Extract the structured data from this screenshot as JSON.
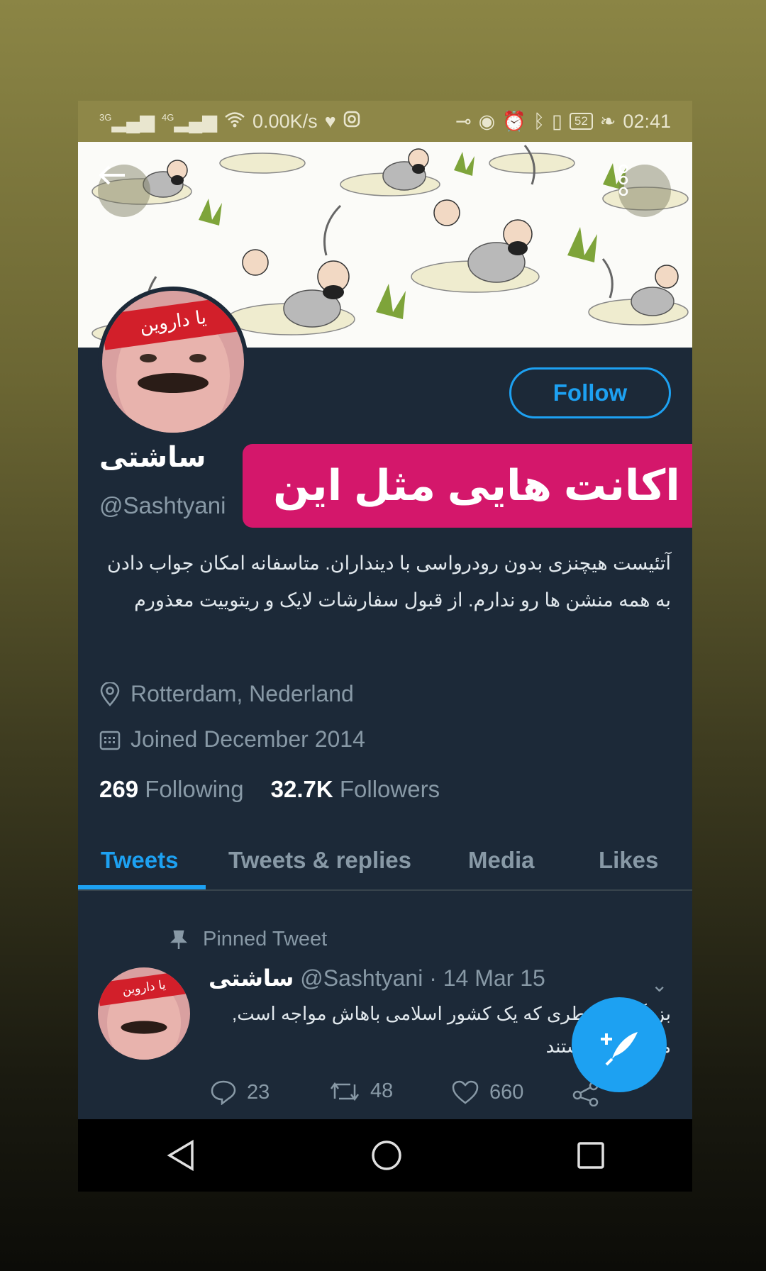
{
  "status_bar": {
    "network1": "3G",
    "network2": "4G",
    "speed": "0.00K/s",
    "battery": "52",
    "time": "02:41"
  },
  "profile": {
    "display_name": "ساشتی",
    "handle": "@Sashtyani",
    "follow_label": "Follow",
    "bio": "آتئیست هیچنزی بدون رودرواسی با دینداران. متاسفانه امکان جواب دادن به همه منشن ها رو ندارم. از قبول سفارشات لایک و ریتوییت معذورم",
    "location": "Rotterdam, Nederland",
    "joined": "Joined December 2014",
    "following_count": "269",
    "following_label": "Following",
    "followers_count": "32.7K",
    "followers_label": "Followers"
  },
  "overlay_caption": "اکانت هایی مثل این",
  "tabs": [
    {
      "label": "Tweets",
      "active": true
    },
    {
      "label": "Tweets & replies",
      "active": false
    },
    {
      "label": "Media",
      "active": false
    },
    {
      "label": "Likes",
      "active": false
    }
  ],
  "pinned_tweet": {
    "pinned_label": "Pinned Tweet",
    "name": "ساشتی",
    "handle": "@Sashtyani",
    "date": "14 Mar 15",
    "separator": "·",
    "text": "بزرگترین خطری که یک کشور اسلامی باهاش مواجه است, مسلمانان هستند",
    "replies": "23",
    "retweets": "48",
    "likes": "660"
  },
  "colors": {
    "accent": "#1da1f2",
    "background": "#1c2938",
    "overlay": "#d4176b"
  }
}
